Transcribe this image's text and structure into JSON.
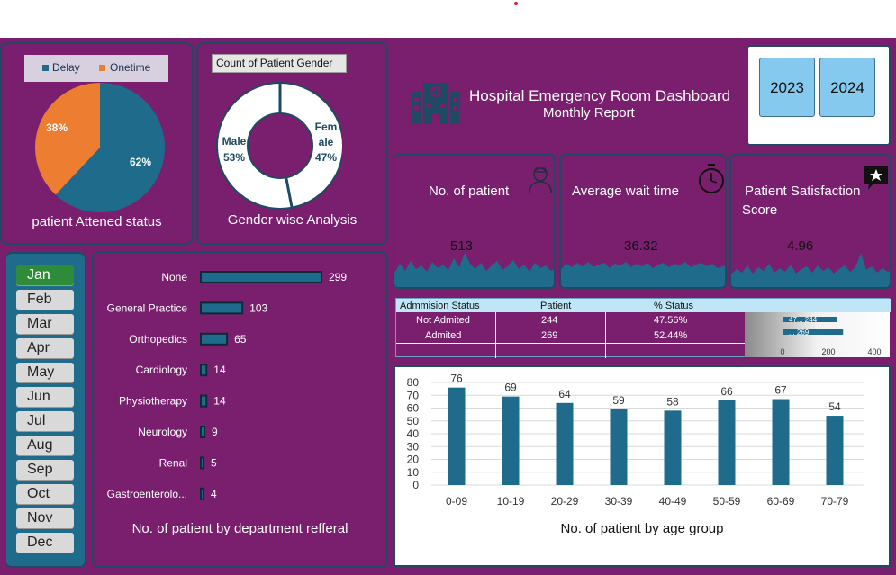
{
  "header": {
    "title": "Hospital Emergency Room Dashboard",
    "subtitle": "Monthly Report",
    "logo_icon": "hospital-building-icon"
  },
  "years": [
    "2023",
    "2024"
  ],
  "months": [
    "Jan",
    "Feb",
    "Mar",
    "Apr",
    "May",
    "Jun",
    "Jul",
    "Aug",
    "Sep",
    "Oct",
    "Nov",
    "Dec"
  ],
  "selected_month": "Jan",
  "attend_status": {
    "title": "patient Attened status",
    "legend": [
      {
        "label": "Delay",
        "color": "#1f6b8c"
      },
      {
        "label": "Onetime",
        "color": "#ed7d31"
      }
    ],
    "slices": [
      {
        "label": "Delay",
        "percent": 62,
        "text": "62%"
      },
      {
        "label": "Onetime",
        "percent": 38,
        "text": "38%"
      }
    ]
  },
  "gender": {
    "header": "Count of Patient Gender",
    "title": "Gender wise Analysis",
    "male_line1": "Male",
    "male_line2": "53%",
    "female_line1": "Fem",
    "female_line2": "ale",
    "female_line3": "47%",
    "male_share": 0.53
  },
  "kpis": [
    {
      "title": "No. of patient",
      "value": "513",
      "icon": "patient-user-icon"
    },
    {
      "title": "Average wait time",
      "value": "36.32",
      "icon": "stopwatch-icon"
    },
    {
      "title": "Patient Satisfaction",
      "title2": "Score",
      "value": "4.96",
      "icon": "star-chat-icon"
    }
  ],
  "admission": {
    "headers": [
      "Admmision Status",
      "Patient",
      "% Status"
    ],
    "rows": [
      {
        "status": "Not Admited",
        "patient": "244",
        "percent": "47.56%"
      },
      {
        "status": "Admited",
        "patient": "269",
        "percent": "52.44%"
      }
    ],
    "mini_chart": {
      "values": [
        244,
        269
      ],
      "labels": [
        "47...  244",
        "...  269"
      ],
      "ticks": [
        "0",
        "200",
        "400"
      ],
      "max": 400
    }
  },
  "chart_data": [
    {
      "type": "bar",
      "orientation": "horizontal",
      "title": "No. of patient by  department refferal",
      "categories": [
        "None",
        "General Practice",
        "Orthopedics",
        "Cardiology",
        "Physiotherapy",
        "Neurology",
        "Renal",
        "Gastroenterolo..."
      ],
      "values": [
        299,
        103,
        65,
        14,
        14,
        9,
        5,
        4
      ]
    },
    {
      "type": "bar",
      "title": "No. of patient by age group",
      "categories": [
        "0-09",
        "10-19",
        "20-29",
        "30-39",
        "40-49",
        "50-59",
        "60-69",
        "70-79"
      ],
      "values": [
        76,
        69,
        64,
        59,
        58,
        66,
        67,
        54
      ],
      "ylim": [
        0,
        80
      ],
      "yticks": [
        "80",
        "70",
        "60",
        "50",
        "40",
        "30",
        "20",
        "10",
        "0"
      ],
      "grid": true
    }
  ]
}
